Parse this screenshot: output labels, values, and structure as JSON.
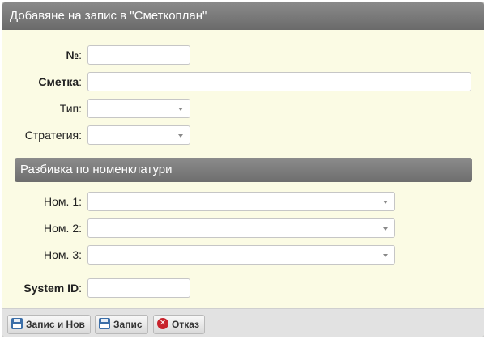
{
  "dialog": {
    "title": "Добавяне на запис в \"Сметкоплан\""
  },
  "form": {
    "number": {
      "label": "№",
      "value": ""
    },
    "account": {
      "label": "Сметка",
      "value": ""
    },
    "type": {
      "label": "Тип",
      "value": ""
    },
    "strategy": {
      "label": "Стратегия",
      "value": ""
    }
  },
  "section": {
    "title": "Разбивка по номенклатури",
    "nom1": {
      "label": "Ном. 1",
      "value": ""
    },
    "nom2": {
      "label": "Ном. 2",
      "value": ""
    },
    "nom3": {
      "label": "Ном. 3",
      "value": ""
    }
  },
  "system_id": {
    "label": "System ID",
    "value": ""
  },
  "footer": {
    "save_new_label": "Запис и Нов",
    "save_label": "Запис",
    "cancel_label": "Отказ"
  },
  "icons": {
    "save": "floppy-disk-icon",
    "cancel": "cancel-icon"
  },
  "colors": {
    "titlebar": "#777777",
    "body": "#fbfbe4",
    "cancel": "#c8232c",
    "save_icon": "#3b6ea8"
  }
}
